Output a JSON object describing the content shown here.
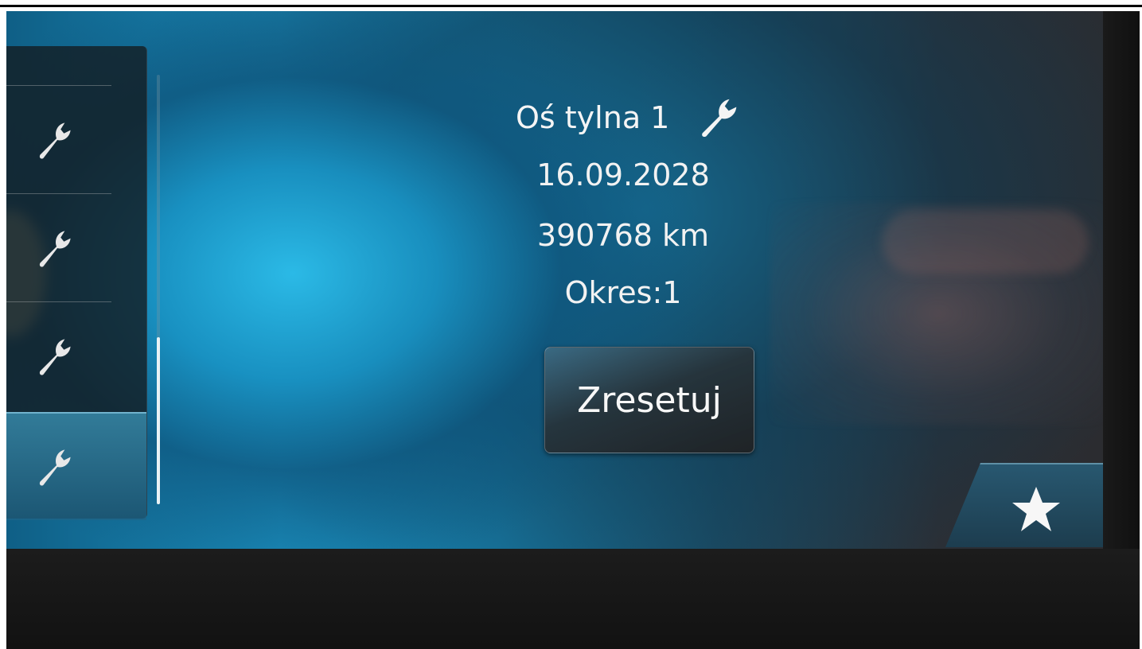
{
  "detail": {
    "title": "Oś tylna 1",
    "date": "16.09.2028",
    "distance": "390768 km",
    "period": "Okres:1",
    "reset_label": "Zresetuj"
  },
  "list": {
    "items": [
      {
        "icon": "wrench-icon"
      },
      {
        "icon": "wrench-icon"
      },
      {
        "icon": "wrench-icon"
      },
      {
        "icon": "wrench-icon",
        "selected": true
      }
    ],
    "scroll_position": 0.9
  },
  "favorites": {
    "icon": "star-icon"
  }
}
